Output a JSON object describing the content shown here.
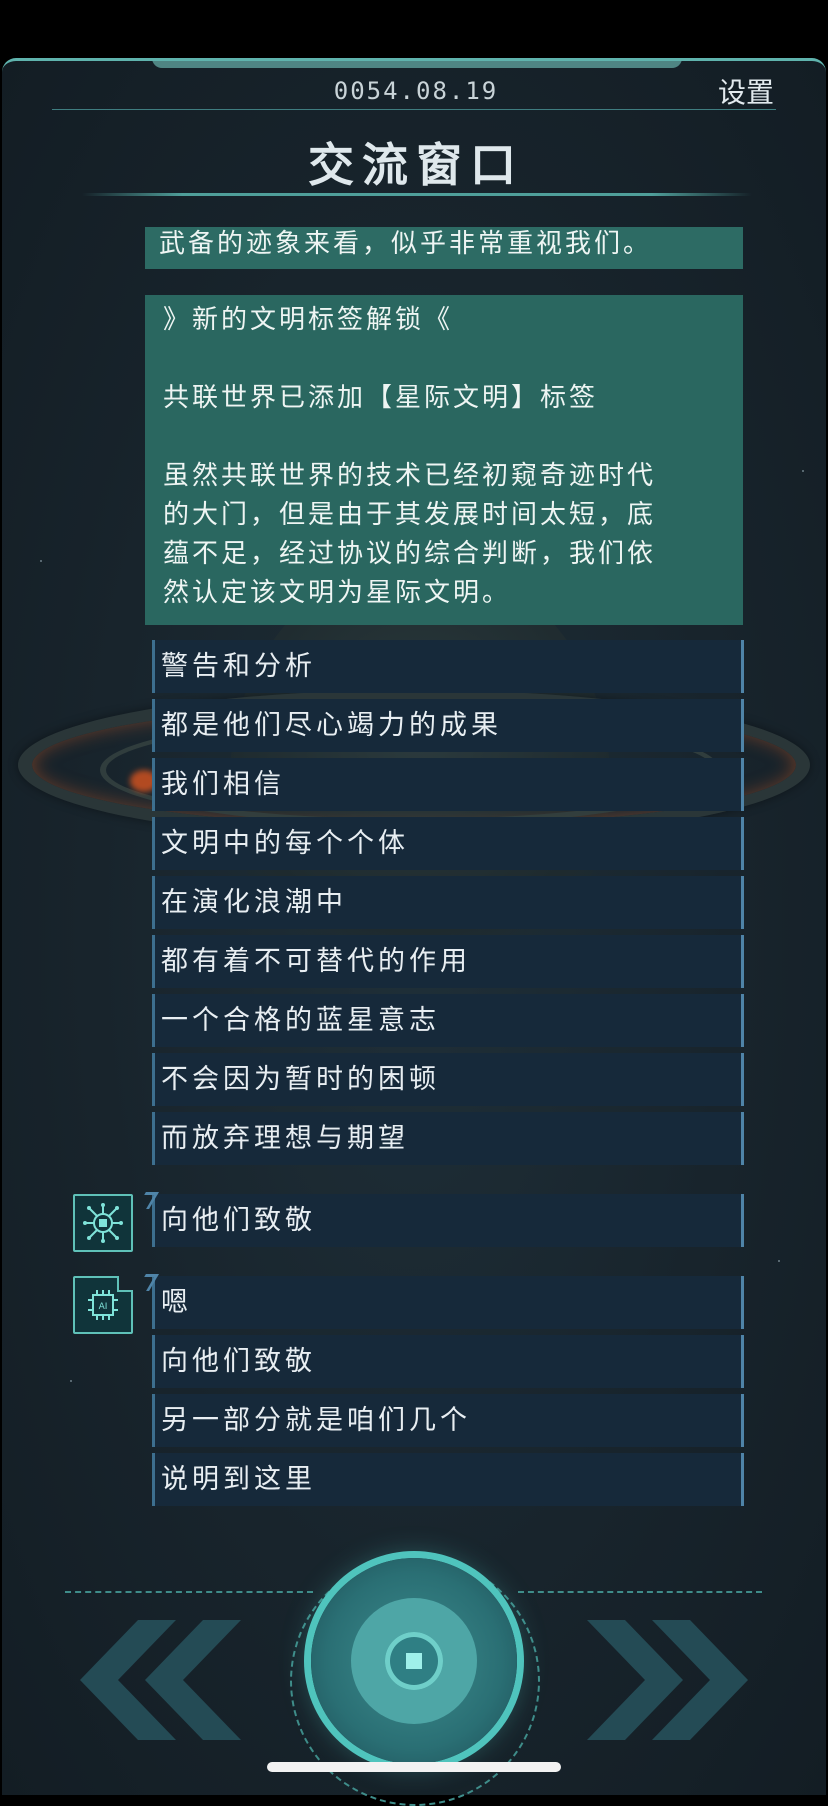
{
  "header": {
    "date": "0054.08.19",
    "settings_label": "设置",
    "title": "交流窗口"
  },
  "messages": {
    "prev_fragment": "武备的迹象来看，似乎非常重视我们。",
    "unlock_title": "》新的文明标签解锁《",
    "unlock_tag_line": "共联世界已添加【星际文明】标签",
    "unlock_body": [
      "虽然共联世界的技术已经初窥奇迹时代",
      "的大门，但是由于其发展时间太短，底",
      "蕴不足，经过协议的综合判断，我们依",
      "然认定该文明为星际文明。"
    ]
  },
  "list1": [
    "警告和分析",
    "都是他们尽心竭力的成果",
    "我们相信",
    "文明中的每个个体",
    "在演化浪潮中",
    "都有着不可替代的作用",
    "一个合格的蓝星意志",
    "不会因为暂时的困顿",
    "而放弃理想与期望"
  ],
  "list2": [
    "向他们致敬"
  ],
  "list3": [
    "嗯",
    "向他们致敬",
    "另一部分就是咱们几个",
    "说明到这里"
  ],
  "avatars": {
    "first": "circuit-chip-icon",
    "second": "ai-chip-icon",
    "second_text": "AI"
  },
  "colors": {
    "accent": "#5fc1b8",
    "message_bg": "#2d6b64",
    "item_bg": "#16293a"
  }
}
